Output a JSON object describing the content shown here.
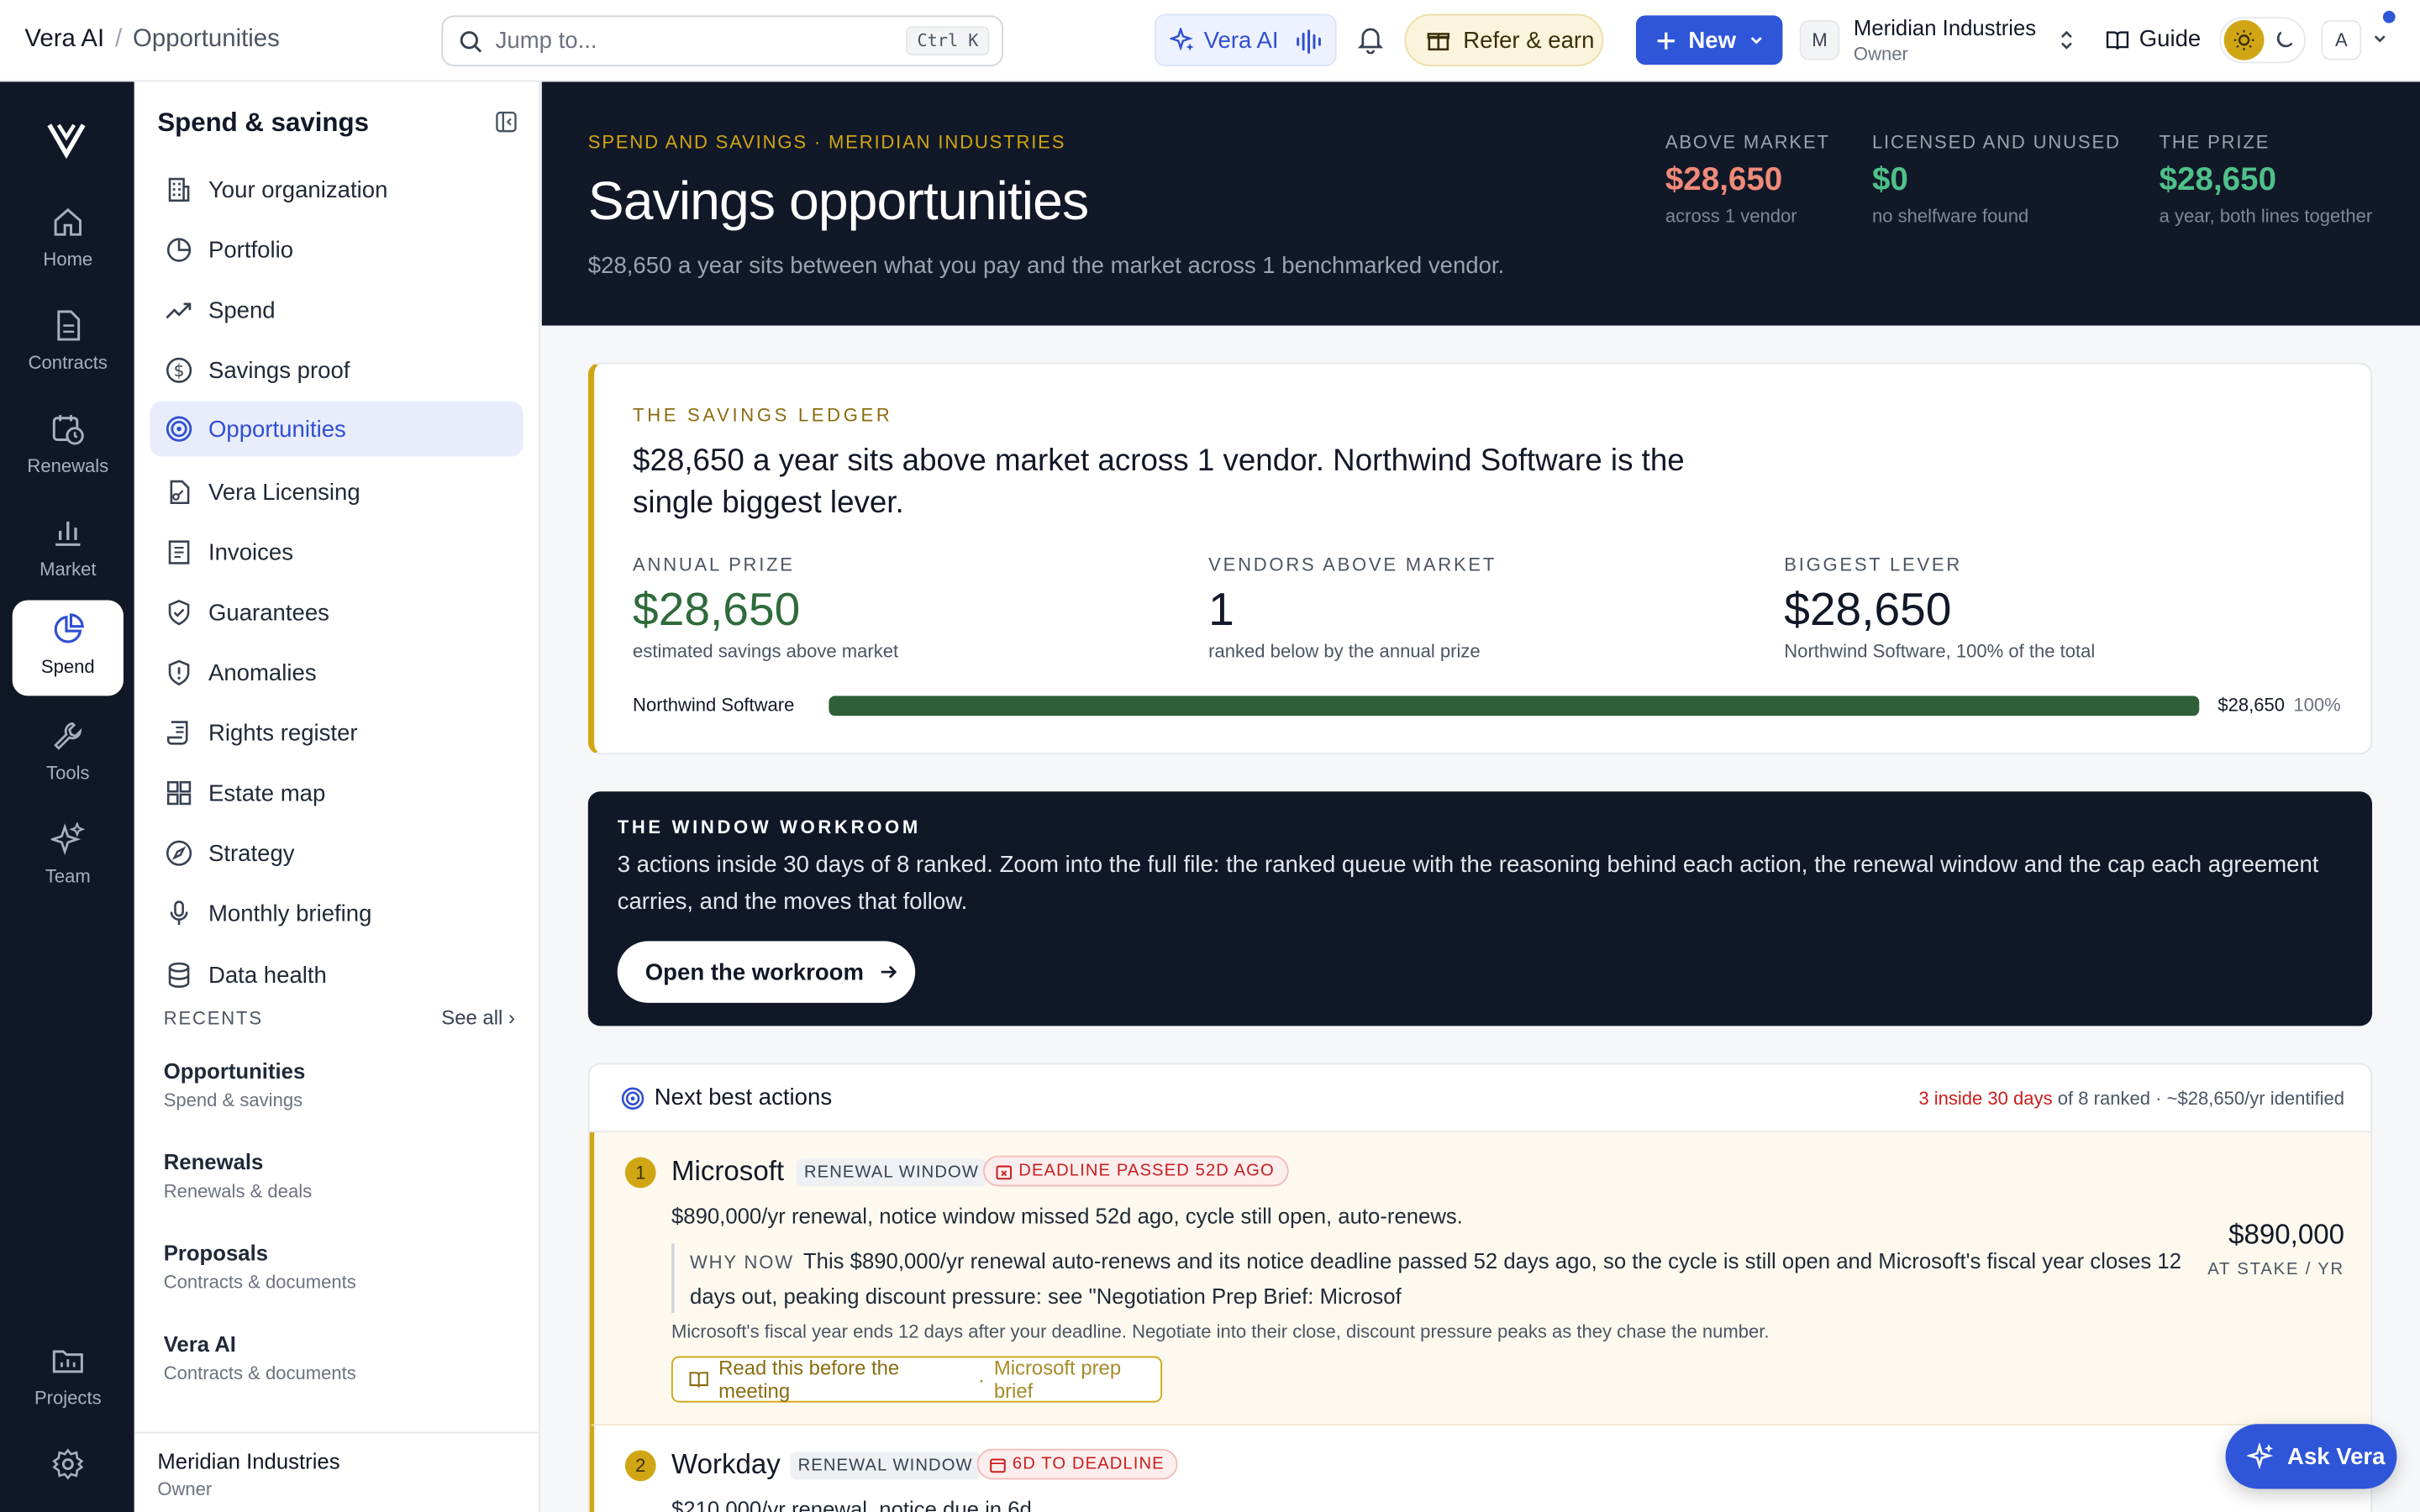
{
  "topbar": {
    "breadcrumb": [
      "Vera AI",
      "Opportunities"
    ],
    "breadcrumb_sep": "/",
    "search_placeholder": "Jump to...",
    "search_shortcut": "Ctrl K",
    "vera_ai_label": "Vera AI",
    "refer_label": "Refer & earn",
    "new_label": "New",
    "org": {
      "initial": "M",
      "name": "Meridian Industries",
      "role": "Owner"
    },
    "guide_label": "Guide",
    "user_initial": "A"
  },
  "rail": {
    "items": [
      {
        "label": "Home",
        "icon": "home-icon"
      },
      {
        "label": "Contracts",
        "icon": "document-icon"
      },
      {
        "label": "Renewals",
        "icon": "calendar-clock-icon"
      },
      {
        "label": "Market",
        "icon": "bar-chart-icon"
      },
      {
        "label": "Spend",
        "icon": "pie-chart-icon"
      },
      {
        "label": "Tools",
        "icon": "wrench-icon"
      },
      {
        "label": "Team",
        "icon": "sparkles-icon"
      },
      {
        "label": "Projects",
        "icon": "folder-chart-icon"
      }
    ],
    "active": "Spend"
  },
  "sidebar": {
    "title": "Spend & savings",
    "items": [
      {
        "label": "Your organization",
        "icon": "building-icon"
      },
      {
        "label": "Portfolio",
        "icon": "pie-icon"
      },
      {
        "label": "Spend",
        "icon": "trend-up-icon"
      },
      {
        "label": "Savings proof",
        "icon": "dollar-circle-icon"
      },
      {
        "label": "Opportunities",
        "icon": "target-icon"
      },
      {
        "label": "Vera Licensing",
        "icon": "file-key-icon"
      },
      {
        "label": "Invoices",
        "icon": "receipt-icon"
      },
      {
        "label": "Guarantees",
        "icon": "shield-check-icon"
      },
      {
        "label": "Anomalies",
        "icon": "shield-alert-icon"
      },
      {
        "label": "Rights register",
        "icon": "scroll-icon"
      },
      {
        "label": "Estate map",
        "icon": "grid-icon"
      },
      {
        "label": "Strategy",
        "icon": "compass-icon"
      },
      {
        "label": "Monthly briefing",
        "icon": "mic-icon"
      },
      {
        "label": "Data health",
        "icon": "database-icon"
      }
    ],
    "active": "Opportunities",
    "recents_label": "RECENTS",
    "see_all": "See all ›",
    "recents": [
      {
        "title": "Opportunities",
        "sub": "Spend & savings"
      },
      {
        "title": "Renewals",
        "sub": "Renewals & deals"
      },
      {
        "title": "Proposals",
        "sub": "Contracts & documents"
      },
      {
        "title": "Vera AI",
        "sub": "Contracts & documents"
      }
    ],
    "footer": {
      "name": "Meridian Industries",
      "role": "Owner"
    }
  },
  "hero": {
    "eyebrow": "SPEND AND SAVINGS · MERIDIAN INDUSTRIES",
    "title": "Savings opportunities",
    "subtitle": "$28,650 a year sits between what you pay and the market across 1 benchmarked vendor.",
    "kpis": [
      {
        "label": "ABOVE MARKET",
        "value": "$28,650",
        "sub": "across 1 vendor",
        "color": "#f08a7a"
      },
      {
        "label": "LICENSED AND UNUSED",
        "value": "$0",
        "sub": "no shelfware found",
        "color": "#4fc08a"
      },
      {
        "label": "THE PRIZE",
        "value": "$28,650",
        "sub": "a year, both lines together",
        "color": "#4fc08a"
      }
    ]
  },
  "ledger": {
    "eyebrow": "THE SAVINGS LEDGER",
    "headline": "$28,650 a year sits above market across 1 vendor. Northwind Software is the single biggest lever.",
    "stats": [
      {
        "label": "ANNUAL PRIZE",
        "value": "$28,650",
        "sub": "estimated savings above market"
      },
      {
        "label": "VENDORS ABOVE MARKET",
        "value": "1",
        "sub": "ranked below by the annual prize"
      },
      {
        "label": "BIGGEST LEVER",
        "value": "$28,650",
        "sub": "Northwind Software, 100% of the total"
      }
    ],
    "bar": {
      "vendor": "Northwind Software",
      "value": "$28,650",
      "percent_label": "100%",
      "fraction": 1.0
    }
  },
  "workroom": {
    "eyebrow": "THE WINDOW WORKROOM",
    "text": "3 actions inside 30 days of 8 ranked. Zoom into the full file: the ranked queue with the reasoning behind each action, the renewal window and the cap each agreement carries, and the moves that follow.",
    "button": "Open the workroom"
  },
  "nba": {
    "title": "Next best actions",
    "summary_red": "3 inside 30 days",
    "summary_rest": " of 8 ranked · ~$28,650/yr identified",
    "actions": [
      {
        "rank": "1",
        "vendor": "Microsoft",
        "tag": "RENEWAL WINDOW",
        "deadline": "DEADLINE PASSED 52D AGO",
        "summary": "$890,000/yr renewal, notice window missed 52d ago, cycle still open, auto-renews.",
        "why_label": "WHY NOW",
        "why_text": "This $890,000/yr renewal auto-renews and its notice deadline passed 52 days ago, so the cycle is still open and Microsoft's fiscal year closes 12 days out, peaking discount pressure: see \"Negotiation Prep Brief: Microsof",
        "note": "Microsoft's fiscal year ends 12 days after your deadline. Negotiate into their close, discount pressure peaks as they chase the number.",
        "read_label": "Read this before the meeting",
        "read_sub": "Microsoft prep brief",
        "stake_value": "$890,000",
        "stake_label": "AT STAKE / YR"
      },
      {
        "rank": "2",
        "vendor": "Workday",
        "tag": "RENEWAL WINDOW",
        "deadline": "6D TO DEADLINE",
        "summary": "$210,000/yr renewal, notice due in 6d"
      }
    ]
  },
  "ask_vera": "Ask Vera",
  "colors": {
    "accent": "#2f56d8",
    "gold": "#d1a614",
    "navy": "#101828",
    "green": "#2e5f36",
    "red": "#c81e1e"
  }
}
